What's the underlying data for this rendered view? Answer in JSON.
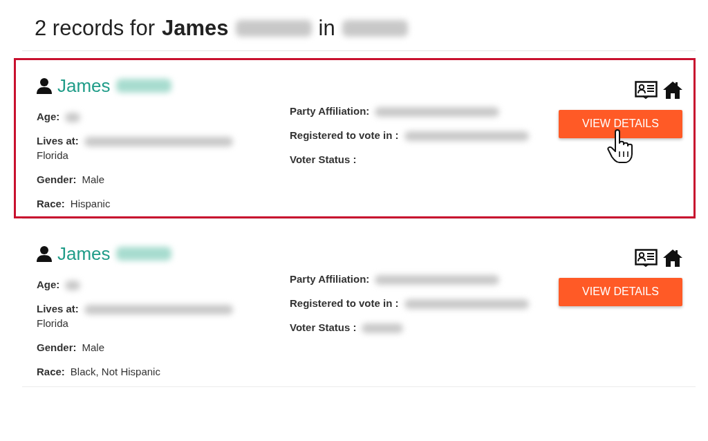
{
  "heading": {
    "prefix": "2 records for",
    "name": "James",
    "surname_redacted": true,
    "joiner": "in",
    "place_redacted": true
  },
  "records": [
    {
      "highlighted": true,
      "first_name": "James",
      "surname_redacted": true,
      "cursor_over_button": true,
      "button": "VIEW DETAILS",
      "left_fields": [
        {
          "label": "Age:",
          "redacted": true
        },
        {
          "label": "Lives at:",
          "redacted": true,
          "value": "Florida"
        },
        {
          "label": "Gender:",
          "value": "Male"
        },
        {
          "label": "Race:",
          "value": "Hispanic"
        }
      ],
      "right_fields": [
        {
          "label": "Party Affiliation:",
          "redacted": true
        },
        {
          "label": "Registered to vote in :",
          "redacted": true
        },
        {
          "label": "Voter Status :",
          "redacted": false
        }
      ]
    },
    {
      "highlighted": false,
      "first_name": "James",
      "surname_redacted": true,
      "cursor_over_button": false,
      "button": "VIEW DETAILS",
      "left_fields": [
        {
          "label": "Age:",
          "redacted": true
        },
        {
          "label": "Lives at:",
          "redacted": true,
          "value": "Florida"
        },
        {
          "label": "Gender:",
          "value": "Male"
        },
        {
          "label": "Race:",
          "value": "Black, Not Hispanic"
        }
      ],
      "right_fields": [
        {
          "label": "Party Affiliation:",
          "redacted": true
        },
        {
          "label": "Registered to vote in :",
          "redacted": true
        },
        {
          "label": "Voter Status :",
          "redacted": true
        }
      ]
    }
  ]
}
